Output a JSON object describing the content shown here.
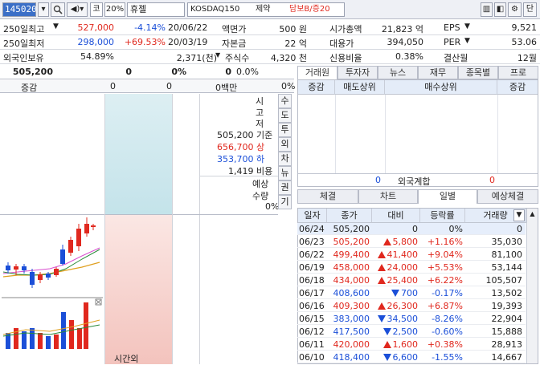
{
  "toolbar": {
    "code": "145020",
    "market": "코",
    "ratio": "20%",
    "name": "휴젤",
    "index": "KOSDAQ150",
    "sector": "제약",
    "margin": "담보B/증20"
  },
  "info": [
    {
      "l1": "250일최고",
      "v1": "527,000",
      "p1": "-4.14%",
      "d1": "20/06/22",
      "l2": "액면가",
      "v2": "500 원",
      "l3": "시가총액",
      "v3": "21,823 억",
      "l4": "EPS",
      "v4": "9,521"
    },
    {
      "l1": "250일최저",
      "v1": "298,000",
      "p1": "+69.53%",
      "d1": "20/03/19",
      "l2": "자본금",
      "v2": "22 억",
      "l3": "대용가",
      "v3": "394,050",
      "l4": "PER",
      "v4": "53.06"
    },
    {
      "l1": "외국인보유",
      "v1": "54.89%",
      "p1": "2,371(천)",
      "d1": "",
      "l2": "주식수",
      "v2": "4,320 천",
      "l3": "신용비율",
      "v3": "0.38%",
      "l4": "결산월",
      "v4": "12월"
    }
  ],
  "quote": {
    "price": "505,200",
    "chg": "0",
    "pct": "0%",
    "vol": "0",
    "vpct": "0.0%",
    "lbl_chg": "증감",
    "c1": "0",
    "c2": "0",
    "amt": "0백만",
    "apct": "0%"
  },
  "mid": {
    "v1": "시",
    "v2": "고",
    "v3": "저",
    "base": "505,200 기준",
    "up": "656,700 상",
    "down": "353,700 하",
    "ratio": "1,419 비용",
    "exp1": "예상",
    "exp2": "수량",
    "exp3": "0%",
    "aftertime": "시간외"
  },
  "vtabs": [
    "수",
    "도",
    "투",
    "외",
    "차",
    "뉴",
    "권",
    "기"
  ],
  "rtabs": [
    "거래원",
    "투자자",
    "뉴스",
    "재무",
    "종목별",
    "프로"
  ],
  "broker": {
    "h1": "증감",
    "h2": "매도상위",
    "h3": "매수상위",
    "h4": "증감",
    "foreign": "외국계합",
    "f1": "0",
    "f2": "0"
  },
  "btabs": [
    "체결",
    "차트",
    "일별",
    "예상체결"
  ],
  "table": {
    "headers": [
      "일자",
      "종가",
      "대비",
      "등락률",
      "거래량"
    ],
    "rows": [
      {
        "d": "06/24",
        "c": "505,200",
        "dir": "",
        "diff": "0",
        "pct": "0%",
        "vol": "0"
      },
      {
        "d": "06/23",
        "c": "505,200",
        "dir": "up",
        "diff": "5,800",
        "pct": "+1.16%",
        "vol": "35,030"
      },
      {
        "d": "06/22",
        "c": "499,400",
        "dir": "up",
        "diff": "41,400",
        "pct": "+9.04%",
        "vol": "81,100"
      },
      {
        "d": "06/19",
        "c": "458,000",
        "dir": "up",
        "diff": "24,000",
        "pct": "+5.53%",
        "vol": "53,144"
      },
      {
        "d": "06/18",
        "c": "434,000",
        "dir": "up",
        "diff": "25,400",
        "pct": "+6.22%",
        "vol": "105,507"
      },
      {
        "d": "06/17",
        "c": "408,600",
        "dir": "dn",
        "diff": "700",
        "pct": "-0.17%",
        "vol": "13,502"
      },
      {
        "d": "06/16",
        "c": "409,300",
        "dir": "up",
        "diff": "26,300",
        "pct": "+6.87%",
        "vol": "19,393"
      },
      {
        "d": "06/15",
        "c": "383,000",
        "dir": "dn",
        "diff": "34,500",
        "pct": "-8.26%",
        "vol": "22,904"
      },
      {
        "d": "06/12",
        "c": "417,500",
        "dir": "dn",
        "diff": "2,500",
        "pct": "-0.60%",
        "vol": "15,888"
      },
      {
        "d": "06/11",
        "c": "420,000",
        "dir": "up",
        "diff": "1,600",
        "pct": "+0.38%",
        "vol": "28,913"
      },
      {
        "d": "06/10",
        "c": "418,400",
        "dir": "dn",
        "diff": "6,600",
        "pct": "-1.55%",
        "vol": "14,667"
      }
    ]
  },
  "colors": {
    "up": "#e0281e",
    "down": "#1b4fd8",
    "header": "#e4ecf8",
    "code_bg": "#3b6fc7"
  }
}
